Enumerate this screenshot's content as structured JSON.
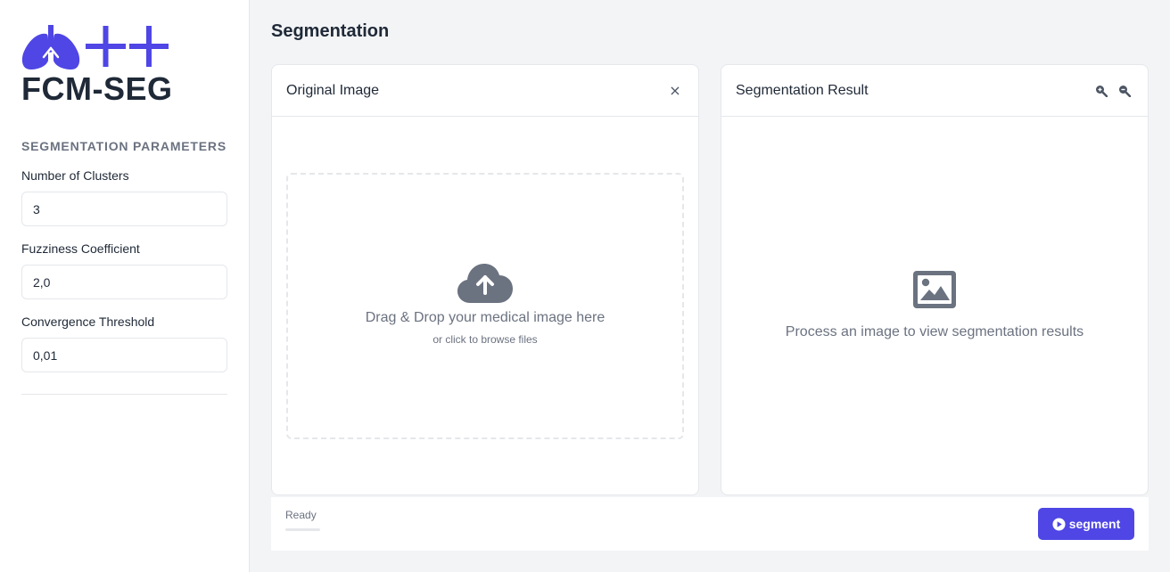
{
  "app": {
    "logo_text": "FCM-SEG"
  },
  "sidebar": {
    "section_title": "SEGMENTATION PARAMETERS",
    "fields": [
      {
        "label": "Number of Clusters",
        "value": "3"
      },
      {
        "label": "Fuzziness Coefficient",
        "value": "2,0"
      },
      {
        "label": "Convergence Threshold",
        "value": "0,01"
      }
    ]
  },
  "main": {
    "page_title": "Segmentation",
    "original_card": {
      "title": "Original Image",
      "close_icon": "×",
      "dropzone_text": "Drag & Drop your medical image here",
      "dropzone_subtext": "or click to browse files"
    },
    "result_card": {
      "title": "Segmentation Result",
      "placeholder_text": "Process an image to view segmentation results"
    }
  },
  "footer": {
    "status_text": "Ready",
    "progress": 0,
    "segment_label": "segment"
  },
  "colors": {
    "accent": "#4f46e5",
    "icon_gray": "#6b7280"
  },
  "icons": [
    "lungs-icon",
    "plus-icon",
    "close-icon",
    "zoom-in-icon",
    "zoom-out-icon",
    "cloud-upload-icon",
    "image-icon",
    "play-circle-icon"
  ]
}
